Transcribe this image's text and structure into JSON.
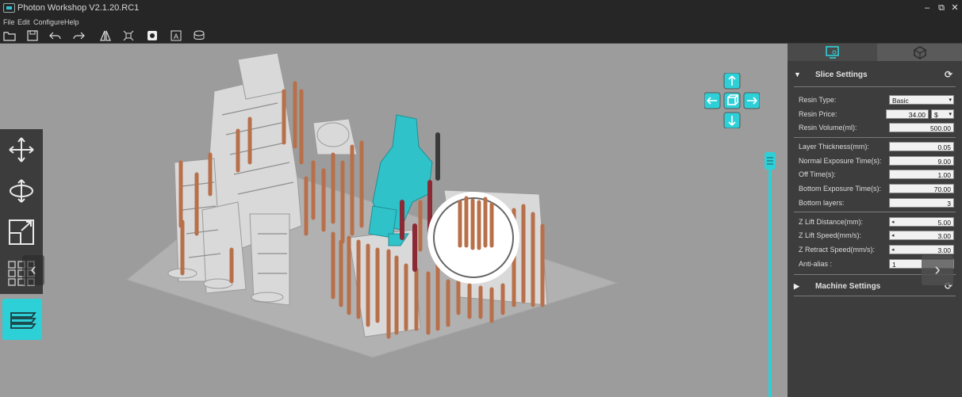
{
  "window": {
    "title": "Photon Workshop V2.1.20.RC1",
    "minimize": "–",
    "maximize": "⧉",
    "close": "✕"
  },
  "menu": [
    "File",
    "Edit",
    "Configure",
    "Help"
  ],
  "toolbar": [
    "open-icon",
    "save-icon",
    "undo-icon",
    "redo-icon",
    "mirror-icon",
    "explode-icon",
    "hollow-icon",
    "text-icon",
    "support-icon"
  ],
  "left_tools": [
    "move-icon",
    "rotate-icon",
    "scale-icon",
    "layout-grid-icon",
    "layers-icon"
  ],
  "panel": {
    "tabs": [
      "slice-settings-tab",
      "model-tab"
    ],
    "slice_settings": {
      "title": "Slice Settings",
      "rows": [
        {
          "label": "Resin Type:",
          "value": "Basic",
          "kind": "select"
        },
        {
          "label": "Resin Price:",
          "value": "34.00",
          "unit": "$",
          "kind": "price"
        },
        {
          "label": "Resin Volume(ml):",
          "value": "500.00",
          "kind": "input"
        },
        {
          "label": "Layer Thickness(mm):",
          "value": "0.05",
          "kind": "input"
        },
        {
          "label": "Normal Exposure Time(s):",
          "value": "9.00",
          "kind": "input"
        },
        {
          "label": "Off Time(s):",
          "value": "1.00",
          "kind": "input"
        },
        {
          "label": "Bottom Exposure Time(s):",
          "value": "70.00",
          "kind": "input"
        },
        {
          "label": "Bottom layers:",
          "value": "3",
          "kind": "input"
        },
        {
          "label": "Z Lift Distance(mm):",
          "value": "5.00",
          "kind": "spin"
        },
        {
          "label": "Z Lift Speed(mm/s):",
          "value": "3.00",
          "kind": "spin"
        },
        {
          "label": "Z Retract Speed(mm/s):",
          "value": "3.00",
          "kind": "spin"
        },
        {
          "label": "Anti-alias :",
          "value": "1",
          "kind": "select"
        }
      ]
    },
    "machine_settings": {
      "title": "Machine Settings"
    }
  },
  "colors": {
    "accent": "#2ed0d8",
    "support": "#b8704a",
    "selected_model": "#2fc3c9",
    "panel_bg": "#3d3d3d",
    "viewport_bg": "#9c9c9c"
  }
}
